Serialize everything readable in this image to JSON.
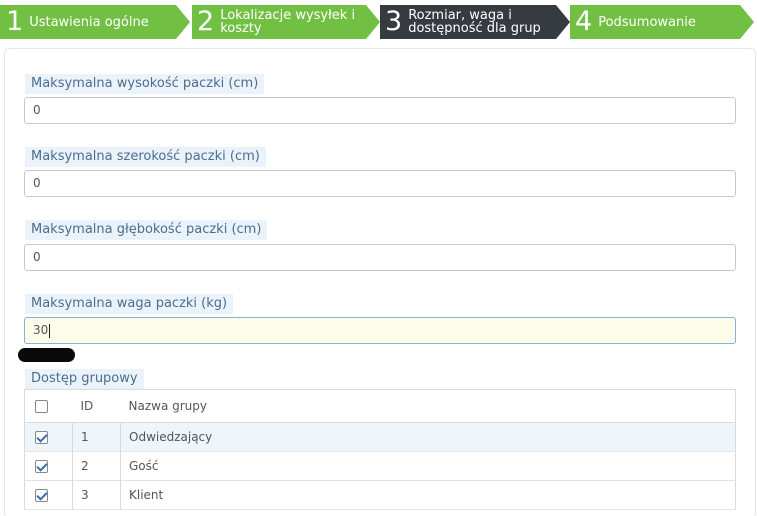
{
  "wizard": {
    "steps": [
      {
        "num": "1",
        "label": "Ustawienia ogólne"
      },
      {
        "num": "2",
        "label_line1": "Lokalizacje wysyłek i",
        "label_line2": "koszty"
      },
      {
        "num": "3",
        "label_line1": "Rozmiar, waga i",
        "label_line2": "dostępność dla grup"
      },
      {
        "num": "4",
        "label": "Podsumowanie"
      }
    ]
  },
  "form": {
    "height_label": "Maksymalna wysokość paczki (cm)",
    "height_value": "0",
    "width_label": "Maksymalna szerokość paczki (cm)",
    "width_value": "0",
    "depth_label": "Maksymalna głębokość paczki (cm)",
    "depth_value": "0",
    "weight_label": "Maksymalna waga paczki (kg)",
    "weight_value": "30",
    "group_access_label": "Dostęp grupowy"
  },
  "groups_table": {
    "headers": {
      "id": "ID",
      "name": "Nazwa grupy"
    },
    "rows": [
      {
        "id": "1",
        "name": "Odwiedzający",
        "checked": true
      },
      {
        "id": "2",
        "name": "Gość",
        "checked": true
      },
      {
        "id": "3",
        "name": "Klient",
        "checked": true
      }
    ]
  },
  "colors": {
    "step_active": "#363a41",
    "step_done": "#72c043"
  }
}
